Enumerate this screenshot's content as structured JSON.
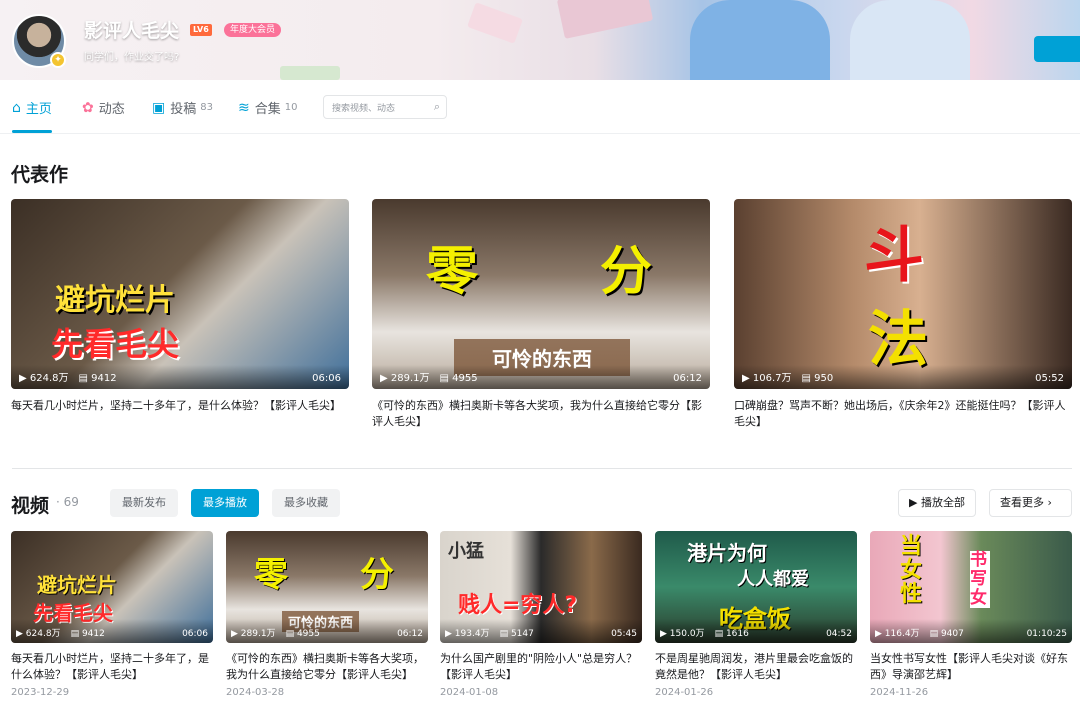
{
  "profile": {
    "name": "影评人毛尖",
    "level": "LV6",
    "vip": "年度大会员",
    "sign": "同学们，作业交了吗?"
  },
  "nav": {
    "tabs": [
      {
        "label": "主页",
        "count": ""
      },
      {
        "label": "动态",
        "count": ""
      },
      {
        "label": "投稿",
        "count": "83"
      },
      {
        "label": "合集",
        "count": "10"
      }
    ],
    "search_placeholder": "搜索视频、动态"
  },
  "featured": {
    "title": "代表作",
    "items": [
      {
        "views": "624.8万",
        "danmaku": "9412",
        "duration": "06:06",
        "title": "每天看几小时烂片，坚持二十多年了，是什么体验？【影评人毛尖】",
        "overlay1": "避坑烂片",
        "overlay2": "先看毛尖"
      },
      {
        "views": "289.1万",
        "danmaku": "4955",
        "duration": "06:12",
        "title": "《可怜的东西》横扫奥斯卡等各大奖项，我为什么直接给它零分【影评人毛尖】",
        "overlay1": "零",
        "overlay2": "分",
        "overlay3": "可怜的东西"
      },
      {
        "views": "106.7万",
        "danmaku": "950",
        "duration": "05:52",
        "title": "口碑崩盘？骂声不断？她出场后，《庆余年2》还能挺住吗？【影评人毛尖】",
        "overlay1": "斗",
        "overlay2": "法"
      }
    ]
  },
  "videos": {
    "title": "视频",
    "count": "· 69",
    "filters": [
      "最新发布",
      "最多播放",
      "最多收藏"
    ],
    "play_all": "▶ 播放全部",
    "more": "查看更多 ›",
    "items": [
      {
        "views": "624.8万",
        "danmaku": "9412",
        "duration": "06:06",
        "title": "每天看几小时烂片，坚持二十多年了，是什么体验？【影评人毛尖】",
        "date": "2023-12-29",
        "overlay1": "避坑烂片",
        "overlay2": "先看毛尖"
      },
      {
        "views": "289.1万",
        "danmaku": "4955",
        "duration": "06:12",
        "title": "《可怜的东西》横扫奥斯卡等各大奖项，我为什么直接给它零分【影评人毛尖】",
        "date": "2024-03-28",
        "overlay1": "零",
        "overlay2": "分",
        "overlay3": "可怜的东西"
      },
      {
        "views": "193.4万",
        "danmaku": "5147",
        "duration": "05:45",
        "title": "为什么国产剧里的\"阴险小人\"总是穷人？【影评人毛尖】",
        "date": "2024-01-08",
        "overlay1": "小猛",
        "overlay2": "贱人=穷人?"
      },
      {
        "views": "150.0万",
        "danmaku": "1616",
        "duration": "04:52",
        "title": "不是周星驰周润发，港片里最会吃盒饭的竟然是他？【影评人毛尖】",
        "date": "2024-01-26",
        "overlay1": "港片为何",
        "overlay2": "人人都爱",
        "overlay3": "吃盒饭"
      },
      {
        "views": "116.4万",
        "danmaku": "9407",
        "duration": "01:10:25",
        "title": "当女性书写女性【影评人毛尖对谈《好东西》导演邵艺辉】",
        "date": "2024-11-26",
        "overlay1": "当女性",
        "overlay2": "书写女"
      }
    ]
  }
}
